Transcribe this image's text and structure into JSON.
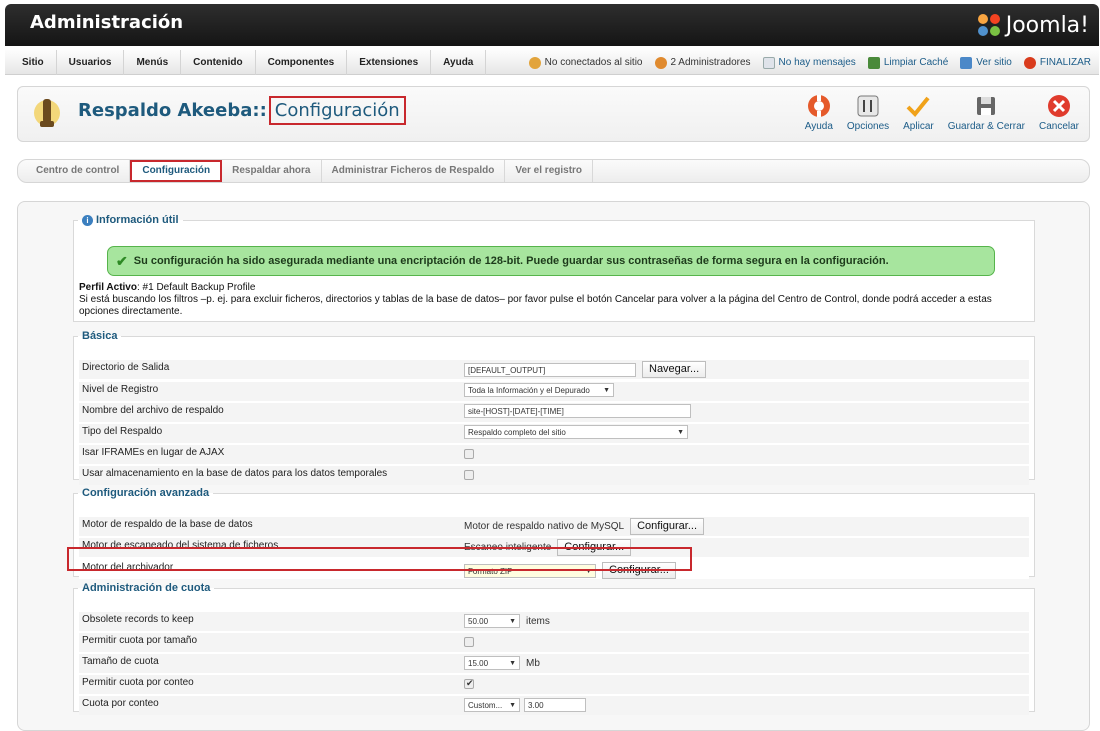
{
  "header": {
    "title": "Administración",
    "logo_text": "Joomla!"
  },
  "menu": [
    "Sitio",
    "Usuarios",
    "Menús",
    "Contenido",
    "Componentes",
    "Extensiones",
    "Ayuda"
  ],
  "status": {
    "not_connected": "No conectados al sitio",
    "admins": "2 Administradores",
    "messages": "No hay mensajes",
    "clear_cache": "Limpiar Caché",
    "view_site": "Ver sitio",
    "logout": "FINALIZAR"
  },
  "page": {
    "title_prefix": "Respaldo Akeeba::",
    "title_boxed": "Configuración"
  },
  "toolbar": {
    "help": "Ayuda",
    "options": "Opciones",
    "apply": "Aplicar",
    "save_close": "Guardar & Cerrar",
    "cancel": "Cancelar"
  },
  "tabs": [
    "Centro de control",
    "Configuración",
    "Respaldar ahora",
    "Administrar Ficheros de Respaldo",
    "Ver el registro"
  ],
  "info": {
    "legend": "Información útil",
    "success_msg": "Su configuración ha sido asegurada mediante una encriptación de 128-bit. Puede guardar sus contraseñas de forma segura en la configuración.",
    "profile_label": "Perfil Activo",
    "profile_value": ": #1 Default Backup Profile",
    "hint": "Si está buscando los filtros –p. ej. para excluir ficheros, directorios y tablas de la base de datos– por favor pulse el botón Cancelar para volver a la página del Centro de Control, donde podrá acceder a estas opciones directamente."
  },
  "basic": {
    "legend": "Básica",
    "output_dir_label": "Directorio de Salida",
    "output_dir_value": "[DEFAULT_OUTPUT]",
    "browse": "Navegar...",
    "log_level_label": "Nivel de Registro",
    "log_level_value": "Toda la Información y el Depurado",
    "archive_name_label": "Nombre del archivo de respaldo",
    "archive_name_value": "site-[HOST]-[DATE]-[TIME]",
    "backup_type_label": "Tipo del Respaldo",
    "backup_type_value": "Respaldo completo del sitio",
    "iframes_label": "Isar IFRAMEs en lugar de AJAX",
    "dbstorage_label": "Usar almacenamiento en la base de datos para los datos temporales"
  },
  "advanced": {
    "legend": "Configuración avanzada",
    "db_engine_label": "Motor de respaldo de la base de datos",
    "db_engine_value": "Motor de respaldo nativo de MySQL",
    "scan_engine_label": "Motor de escaneado del sistema de ficheros",
    "scan_engine_value": "Escaneo inteligente",
    "archiver_label": "Motor del archivador",
    "archiver_value": "Formato ZIP",
    "configure": "Configurar..."
  },
  "quota": {
    "legend": "Administración de cuota",
    "obsolete_label": "Obsolete records to keep",
    "obsolete_value": "50.00",
    "obsolete_unit": "items",
    "size_quota_enable_label": "Permitir cuota por tamaño",
    "size_quota_label": "Tamaño de cuota",
    "size_quota_value": "15.00",
    "size_quota_unit": "Mb",
    "count_quota_enable_label": "Permitir cuota por conteo",
    "count_quota_label": "Cuota por conteo",
    "count_quota_select": "Custom...",
    "count_quota_value": "3.00"
  }
}
